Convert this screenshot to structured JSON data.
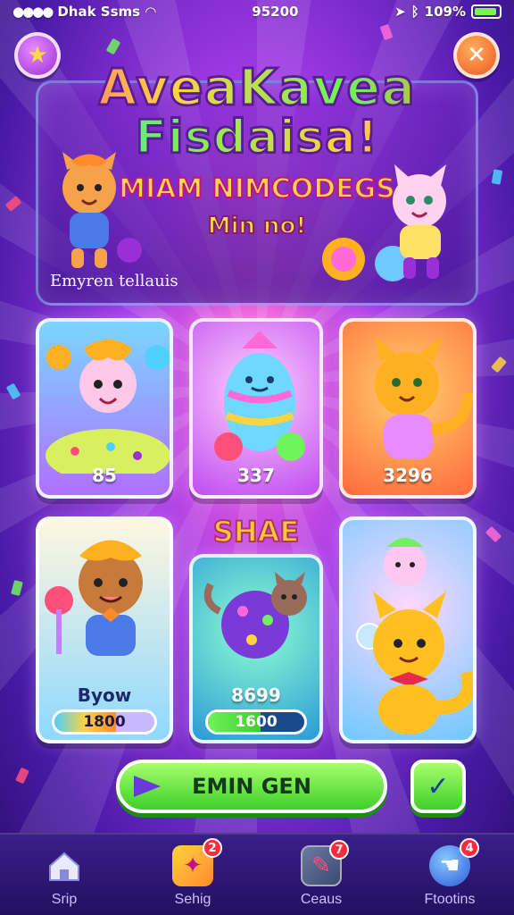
{
  "status_bar": {
    "carrier": "Dhak Ssms",
    "time": "95200",
    "battery": "109%"
  },
  "banner": {
    "title_line1": "AveaKavea",
    "title_line2": "Fisdaisa!",
    "subtitle": "MIAM NIMCODEGS",
    "tagline": "Min no!",
    "caption": "Emyren tellauis"
  },
  "cards": {
    "card1": {
      "value": "85"
    },
    "card2": {
      "value": "337"
    },
    "card3": {
      "value": "3296"
    },
    "card4": {
      "name": "Byow",
      "bar_value": "1800",
      "progress": 0.62
    },
    "card5": {
      "name": "8699",
      "bar_value": "1600",
      "progress": 0.55
    }
  },
  "section_label": "SHAE",
  "main_button_label": "EMIN GEN",
  "nav": [
    {
      "label": "Srip",
      "badge": ""
    },
    {
      "label": "Sehig",
      "badge": "2"
    },
    {
      "label": "Ceaus",
      "badge": "7"
    },
    {
      "label": "Ftootins",
      "badge": "4"
    }
  ],
  "colors": {
    "accent_green": "#3ed02a",
    "accent_purple": "#a43be8",
    "badge_red": "#ff2a3a"
  }
}
